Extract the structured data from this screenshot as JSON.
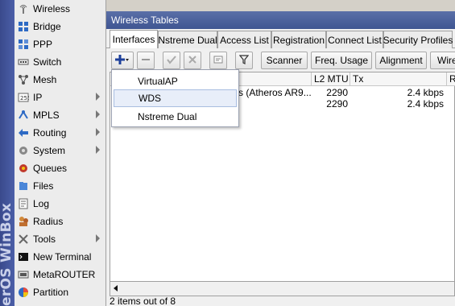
{
  "brand": {
    "text": "erOS WinBox"
  },
  "sidebar": {
    "items": [
      {
        "label": "Wireless",
        "icon": "wireless-icon",
        "submenu": false
      },
      {
        "label": "Bridge",
        "icon": "bridge-icon",
        "submenu": false
      },
      {
        "label": "PPP",
        "icon": "ppp-icon",
        "submenu": false
      },
      {
        "label": "Switch",
        "icon": "switch-icon",
        "submenu": false
      },
      {
        "label": "Mesh",
        "icon": "mesh-icon",
        "submenu": false
      },
      {
        "label": "IP",
        "icon": "ip-icon",
        "submenu": true
      },
      {
        "label": "MPLS",
        "icon": "mpls-icon",
        "submenu": true
      },
      {
        "label": "Routing",
        "icon": "routing-icon",
        "submenu": true
      },
      {
        "label": "System",
        "icon": "system-icon",
        "submenu": true
      },
      {
        "label": "Queues",
        "icon": "queues-icon",
        "submenu": false
      },
      {
        "label": "Files",
        "icon": "files-icon",
        "submenu": false
      },
      {
        "label": "Log",
        "icon": "log-icon",
        "submenu": false
      },
      {
        "label": "Radius",
        "icon": "radius-icon",
        "submenu": false
      },
      {
        "label": "Tools",
        "icon": "tools-icon",
        "submenu": true
      },
      {
        "label": "New Terminal",
        "icon": "terminal-icon",
        "submenu": false
      },
      {
        "label": "MetaROUTER",
        "icon": "metarouter-icon",
        "submenu": false
      },
      {
        "label": "Partition",
        "icon": "partition-icon",
        "submenu": false
      }
    ]
  },
  "window": {
    "title": "Wireless Tables",
    "tabs": [
      "Interfaces",
      "Nstreme Dual",
      "Access List",
      "Registration",
      "Connect List",
      "Security Profiles"
    ],
    "active_tab": "Interfaces",
    "toolbar": {
      "scanner": "Scanner",
      "freq_usage": "Freq. Usage",
      "alignment": "Alignment",
      "wireless_sniffer": "Wire"
    },
    "table": {
      "columns": [
        "L2 MTU",
        "Tx",
        "R"
      ],
      "rows": [
        {
          "type": "ss (Atheros AR9...",
          "l2mtu": "2290",
          "tx": "2.4 kbps"
        },
        {
          "type": "",
          "l2mtu": "2290",
          "tx": "2.4 kbps"
        }
      ]
    },
    "status": "2 items out of 8"
  },
  "add_menu": {
    "items": [
      "VirtualAP",
      "WDS",
      "Nstreme Dual"
    ],
    "selected": "WDS"
  },
  "colors": {
    "title_bar": "#3f5592",
    "brand_strip": "#3a4a8c",
    "add_plus": "#1d3f9a",
    "filter_icon": "#333333"
  }
}
